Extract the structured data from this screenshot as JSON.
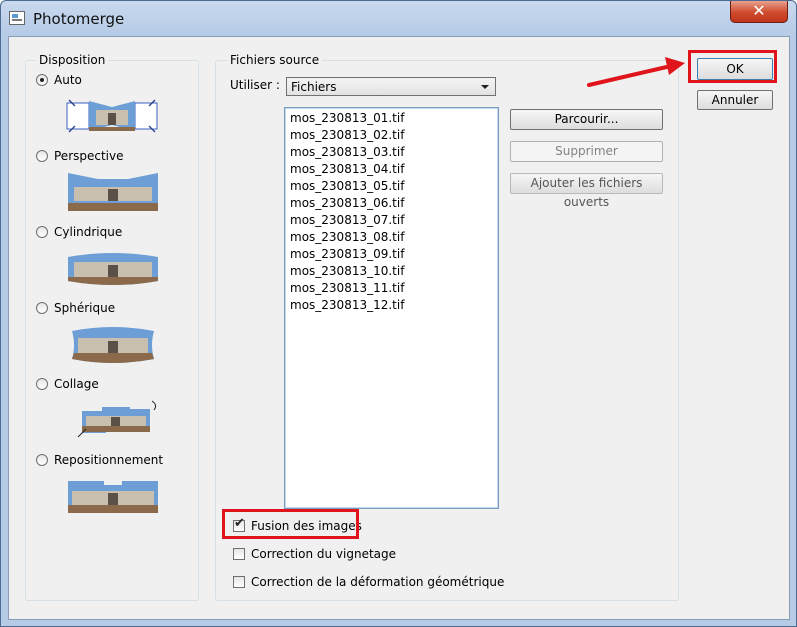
{
  "window": {
    "title": "Photomerge",
    "close_label": "✕"
  },
  "disposition": {
    "legend": "Disposition",
    "options": [
      {
        "label": "Auto",
        "selected": true
      },
      {
        "label": "Perspective",
        "selected": false
      },
      {
        "label": "Cylindrique",
        "selected": false
      },
      {
        "label": "Sphérique",
        "selected": false
      },
      {
        "label": "Collage",
        "selected": false
      },
      {
        "label": "Repositionnement",
        "selected": false
      }
    ]
  },
  "source": {
    "legend": "Fichiers source",
    "use_label": "Utiliser :",
    "use_value": "Fichiers",
    "files": [
      "mos_230813_01.tif",
      "mos_230813_02.tif",
      "mos_230813_03.tif",
      "mos_230813_04.tif",
      "mos_230813_05.tif",
      "mos_230813_06.tif",
      "mos_230813_07.tif",
      "mos_230813_08.tif",
      "mos_230813_09.tif",
      "mos_230813_10.tif",
      "mos_230813_11.tif",
      "mos_230813_12.tif"
    ],
    "browse_label": "Parcourir...",
    "remove_label": "Supprimer",
    "add_open_label": "Ajouter les fichiers ouverts"
  },
  "options": {
    "blend": {
      "label": "Fusion des images",
      "checked": true
    },
    "vignette": {
      "label": "Correction du vignetage",
      "checked": false
    },
    "distortion": {
      "label": "Correction de la déformation géométrique",
      "checked": false
    }
  },
  "actions": {
    "ok_label": "OK",
    "cancel_label": "Annuler"
  },
  "colors": {
    "annotation": "#e0141b",
    "sky": "#6d9fd6",
    "building": "#c9bfae",
    "ground": "#8a6a4a"
  }
}
